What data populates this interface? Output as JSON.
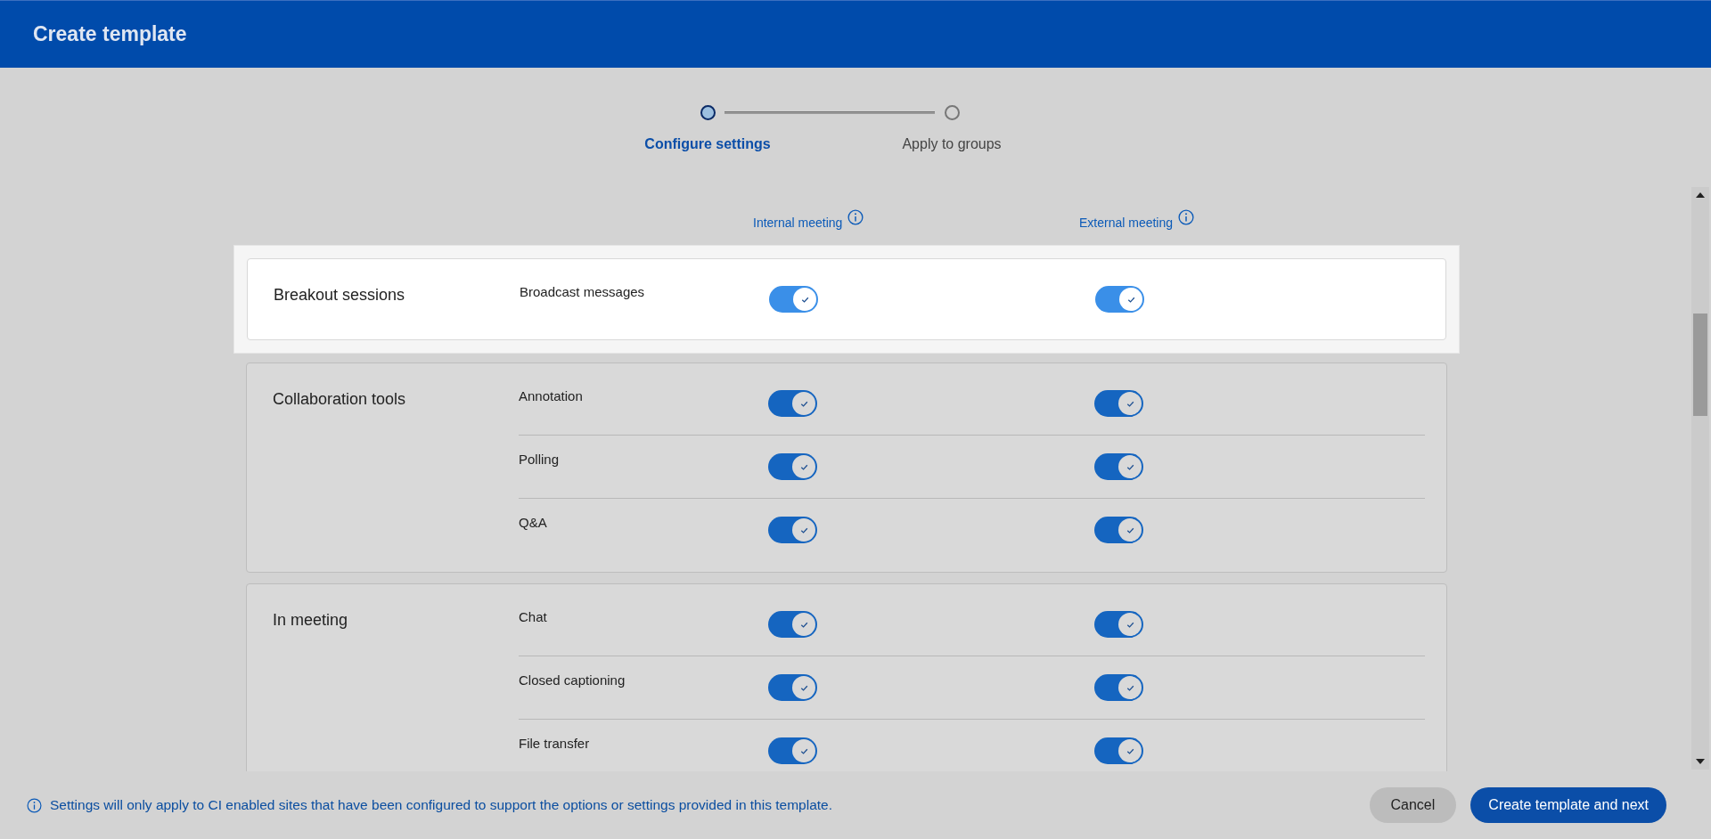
{
  "window": {
    "title": "Create template"
  },
  "steps": [
    {
      "label": "Configure settings",
      "selected": true
    },
    {
      "label": "Apply to groups",
      "selected": false
    }
  ],
  "columns": [
    "Internal meeting",
    "External meeting"
  ],
  "groups": [
    {
      "label": "Breakout sessions",
      "highlighted": true,
      "settings": [
        {
          "label": "Broadcast messages",
          "internal_on": true,
          "external_on": true
        }
      ]
    },
    {
      "label": "Collaboration tools",
      "highlighted": false,
      "settings": [
        {
          "label": "Annotation",
          "internal_on": true,
          "external_on": true
        },
        {
          "label": "Polling",
          "internal_on": true,
          "external_on": true
        },
        {
          "label": "Q&A",
          "internal_on": true,
          "external_on": true
        }
      ]
    },
    {
      "label": "In meeting",
      "highlighted": false,
      "settings": [
        {
          "label": "Chat",
          "internal_on": true,
          "external_on": true
        },
        {
          "label": "Closed captioning",
          "internal_on": true,
          "external_on": true
        },
        {
          "label": "File transfer",
          "internal_on": true,
          "external_on": true
        }
      ]
    }
  ],
  "footer": {
    "note": "Settings will only apply to CI enabled sites that have been configured to support the options or settings provided in this template.",
    "buttons": [
      "Cancel",
      "Create template and next"
    ]
  }
}
